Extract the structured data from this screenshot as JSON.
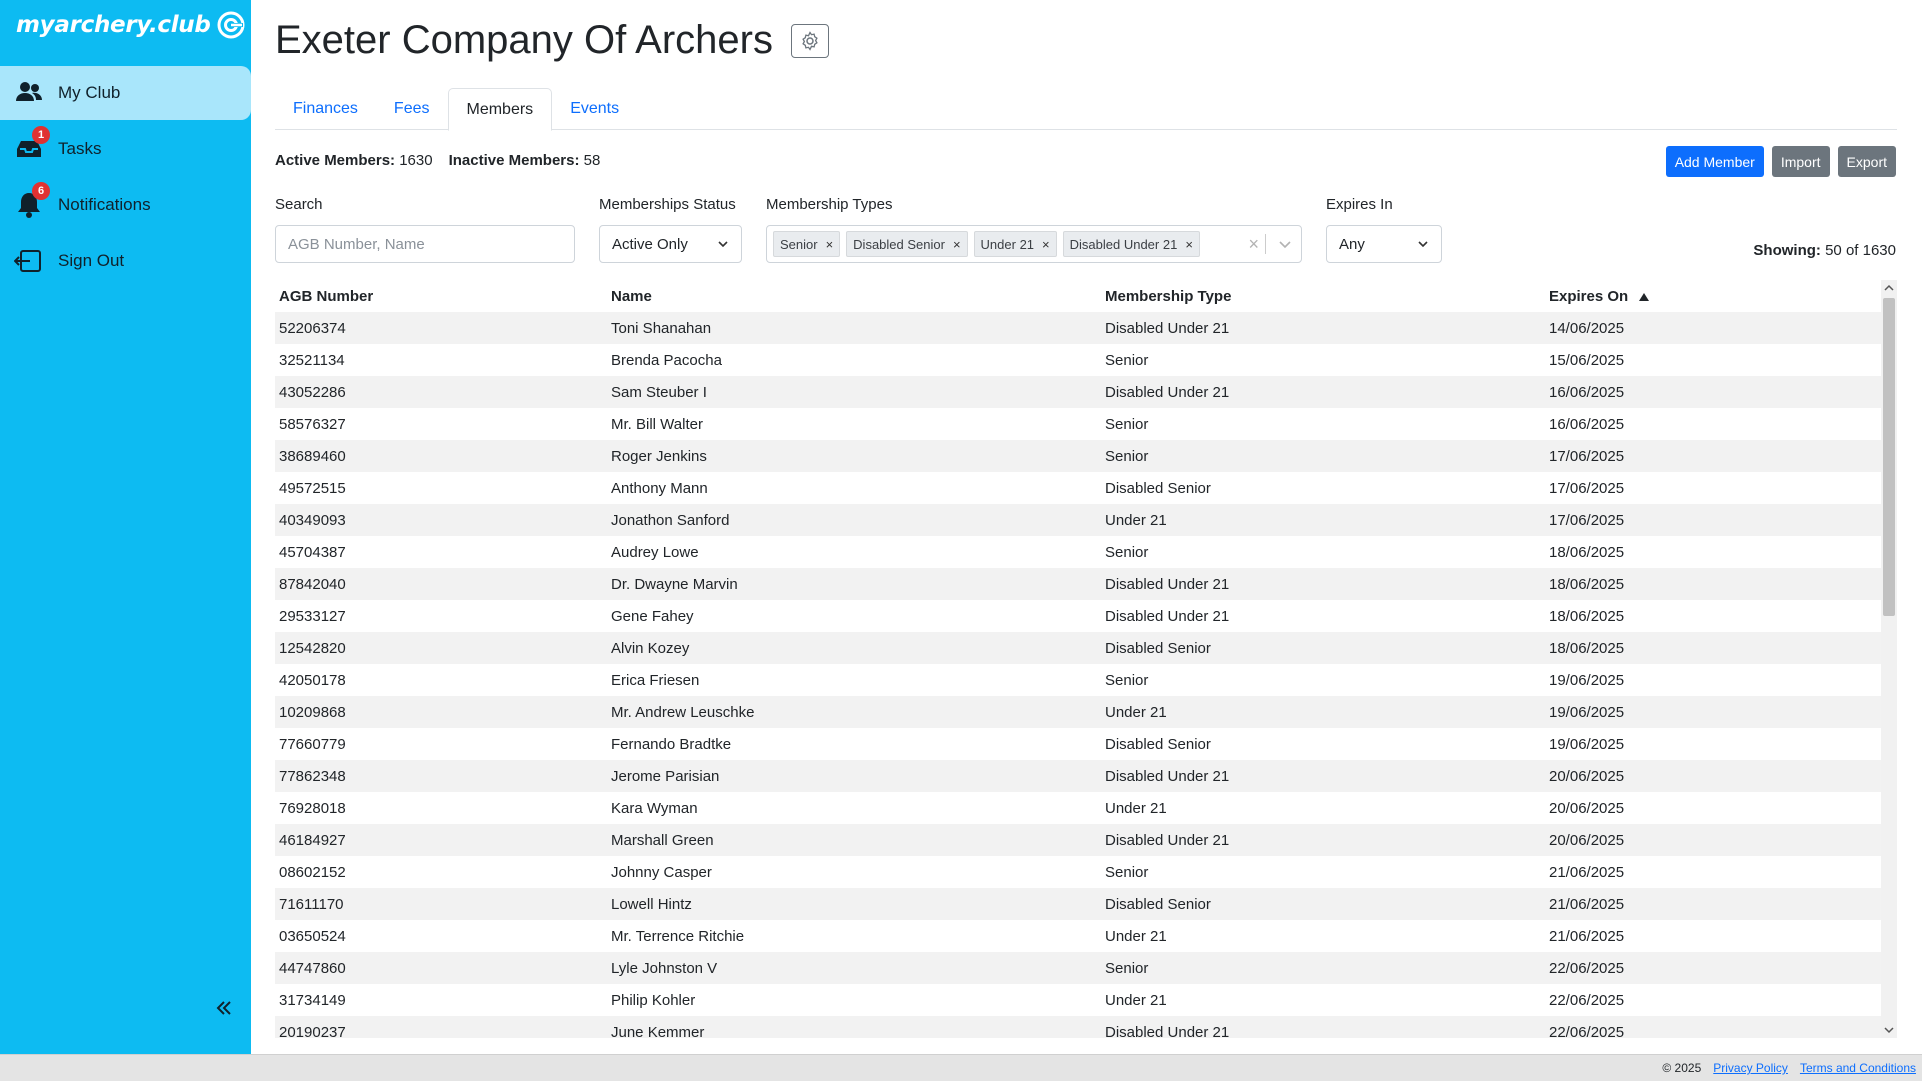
{
  "brand": {
    "name": "myarchery.club"
  },
  "sidebar": {
    "items": [
      {
        "label": "My Club",
        "icon": "users-icon",
        "badge": ""
      },
      {
        "label": "Tasks",
        "icon": "inbox-icon",
        "badge": "1"
      },
      {
        "label": "Notifications",
        "icon": "bell-icon",
        "badge": "6"
      },
      {
        "label": "Sign Out",
        "icon": "sign-out-icon",
        "badge": ""
      }
    ],
    "collapse_icon": "double-chevron-left-icon"
  },
  "header": {
    "title": "Exeter Company Of Archers",
    "settings_icon": "gear-icon"
  },
  "tabs": [
    {
      "label": "Finances"
    },
    {
      "label": "Fees"
    },
    {
      "label": "Members"
    },
    {
      "label": "Events"
    }
  ],
  "active_tab": "Members",
  "stats": {
    "active_label": "Active Members:",
    "active_value": "1630",
    "inactive_label": "Inactive Members:",
    "inactive_value": "58"
  },
  "actions": {
    "add": "Add Member",
    "import": "Import",
    "export": "Export"
  },
  "filters": {
    "search_label": "Search",
    "search_placeholder": "AGB Number, Name",
    "status_label": "Memberships Status",
    "status_value": "Active Only",
    "types_label": "Membership Types",
    "types_selected": [
      "Senior",
      "Disabled Senior",
      "Under 21",
      "Disabled Under 21"
    ],
    "expires_label": "Expires In",
    "expires_value": "Any"
  },
  "showing": {
    "label": "Showing:",
    "value": "50 of 1630"
  },
  "table": {
    "headers": [
      "AGB Number",
      "Name",
      "Membership Type",
      "Expires On"
    ],
    "sorted_column": "Expires On",
    "sort_direction": "ascending",
    "rows": [
      [
        "52206374",
        "Toni Shanahan",
        "Disabled Under 21",
        "14/06/2025"
      ],
      [
        "32521134",
        "Brenda Pacocha",
        "Senior",
        "15/06/2025"
      ],
      [
        "43052286",
        "Sam Steuber I",
        "Disabled Under 21",
        "16/06/2025"
      ],
      [
        "58576327",
        "Mr. Bill Walter",
        "Senior",
        "16/06/2025"
      ],
      [
        "38689460",
        "Roger Jenkins",
        "Senior",
        "17/06/2025"
      ],
      [
        "49572515",
        "Anthony Mann",
        "Disabled Senior",
        "17/06/2025"
      ],
      [
        "40349093",
        "Jonathon Sanford",
        "Under 21",
        "17/06/2025"
      ],
      [
        "45704387",
        "Audrey Lowe",
        "Senior",
        "18/06/2025"
      ],
      [
        "87842040",
        "Dr. Dwayne Marvin",
        "Disabled Under 21",
        "18/06/2025"
      ],
      [
        "29533127",
        "Gene Fahey",
        "Disabled Under 21",
        "18/06/2025"
      ],
      [
        "12542820",
        "Alvin Kozey",
        "Disabled Senior",
        "18/06/2025"
      ],
      [
        "42050178",
        "Erica Friesen",
        "Senior",
        "19/06/2025"
      ],
      [
        "10209868",
        "Mr. Andrew Leuschke",
        "Under 21",
        "19/06/2025"
      ],
      [
        "77660779",
        "Fernando Bradtke",
        "Disabled Senior",
        "19/06/2025"
      ],
      [
        "77862348",
        "Jerome Parisian",
        "Disabled Under 21",
        "20/06/2025"
      ],
      [
        "76928018",
        "Kara Wyman",
        "Under 21",
        "20/06/2025"
      ],
      [
        "46184927",
        "Marshall Green",
        "Disabled Under 21",
        "20/06/2025"
      ],
      [
        "08602152",
        "Johnny Casper",
        "Senior",
        "21/06/2025"
      ],
      [
        "71611170",
        "Lowell Hintz",
        "Disabled Senior",
        "21/06/2025"
      ],
      [
        "03650524",
        "Mr. Terrence Ritchie",
        "Under 21",
        "21/06/2025"
      ],
      [
        "44747860",
        "Lyle Johnston V",
        "Senior",
        "22/06/2025"
      ],
      [
        "31734149",
        "Philip Kohler",
        "Under 21",
        "22/06/2025"
      ],
      [
        "20190237",
        "June Kemmer",
        "Disabled Under 21",
        "22/06/2025"
      ]
    ]
  },
  "footer": {
    "copyright": "© 2025",
    "privacy": "Privacy Policy",
    "terms": "Terms and Conditions"
  },
  "colors": {
    "sidebar": "#0dbbf2",
    "sidebar_active": "#a9e6fb",
    "primary": "#0d6efd",
    "secondary": "#6c757d",
    "badge": "#e03232"
  }
}
